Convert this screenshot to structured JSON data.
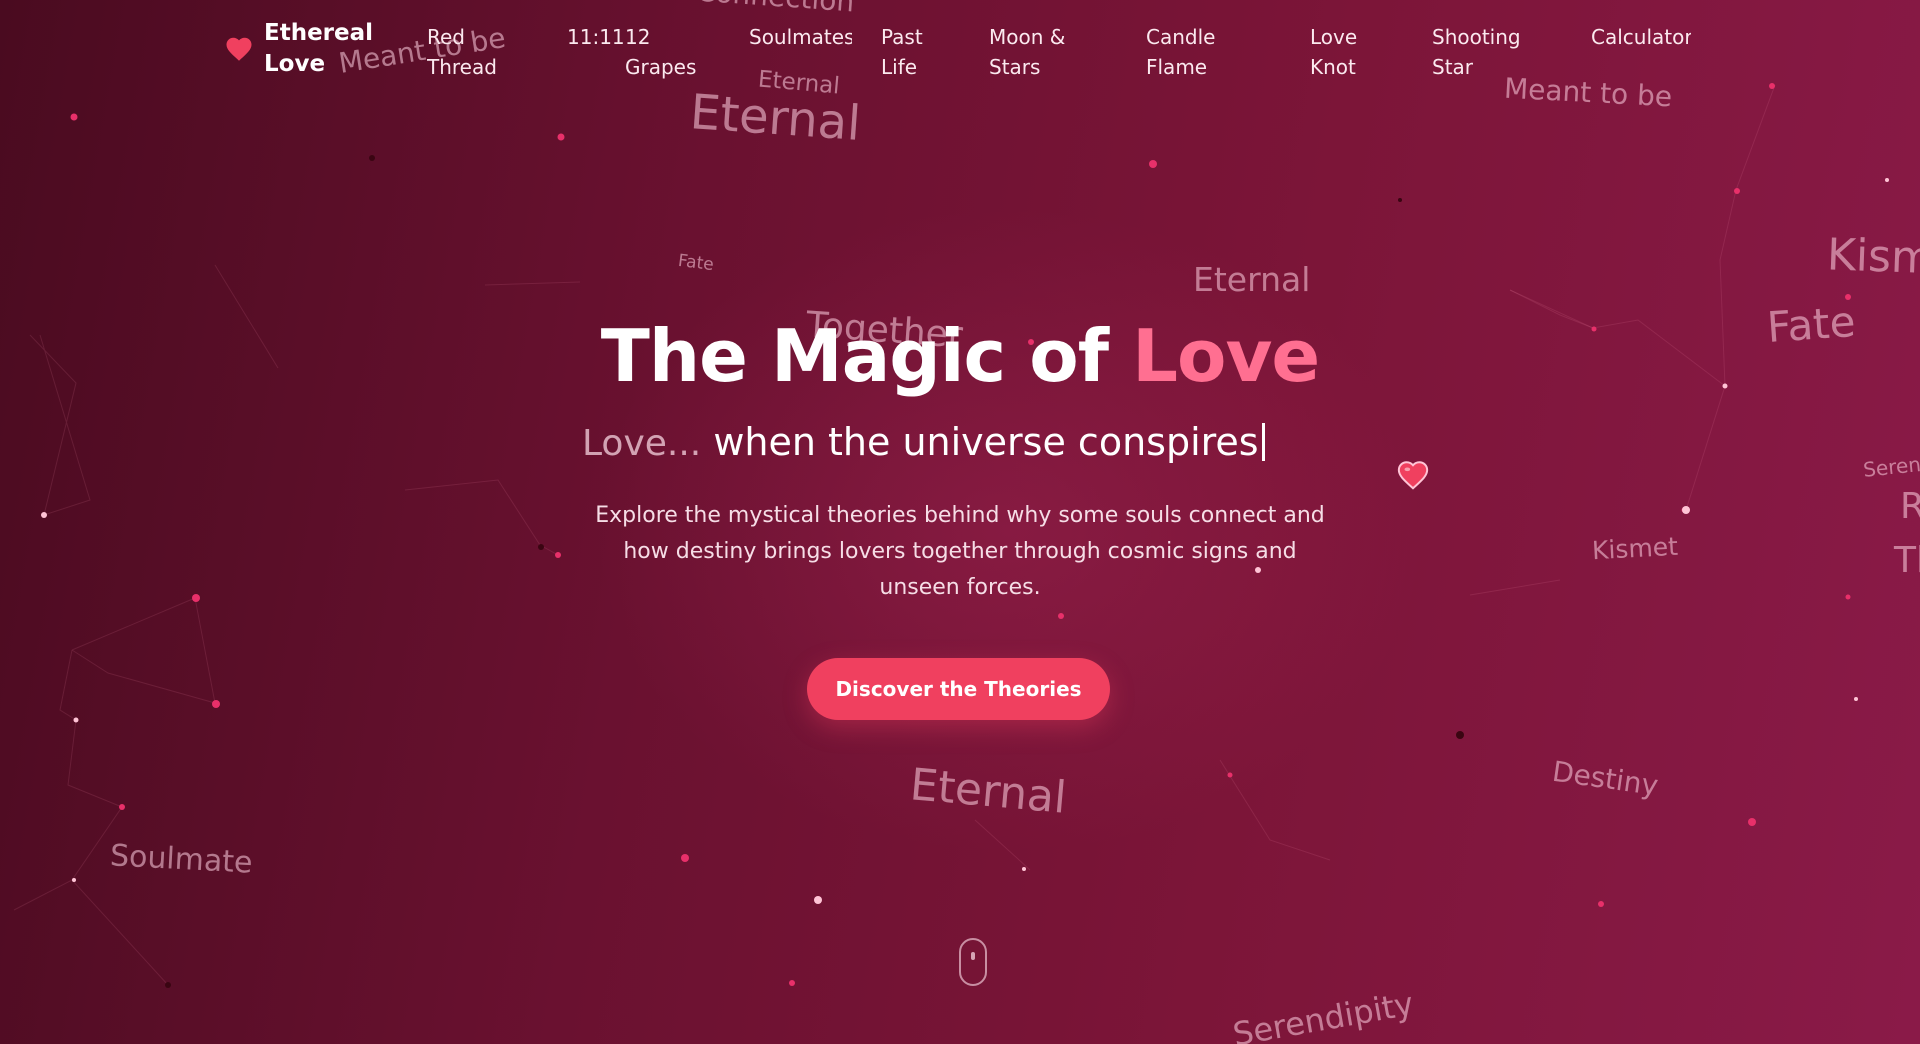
{
  "brand": {
    "name": "Ethereal Love",
    "icon": "heart-icon",
    "color": "#f0405f"
  },
  "nav": {
    "items": [
      {
        "label": "Red Thread"
      },
      {
        "label": "11:11"
      },
      {
        "label": "12 Grapes"
      },
      {
        "label": "Soulmates"
      },
      {
        "label": "Past Life"
      },
      {
        "label": "Moon & Stars"
      },
      {
        "label": "Candle Flame"
      },
      {
        "label": "Love Knot"
      },
      {
        "label": "Shooting Star"
      },
      {
        "label": "Calculator"
      }
    ]
  },
  "hero": {
    "title_main": "The Magic of ",
    "title_accent": "Love",
    "tagline_prefix": "Love...",
    "tagline_rest": " when the universe conspires",
    "description": "Explore the mystical theories behind why some souls connect and how destiny brings lovers together through cosmic signs and unseen forces.",
    "cta_label": "Discover the Theories"
  },
  "floating_words": [
    "Meant to be",
    "Connection",
    "Eternal",
    "Eternal",
    "Meant to be",
    "Fate",
    "Eternal",
    "Together",
    "Kismet",
    "Fate",
    "Serendipity",
    "R",
    "Tl",
    "Kismet",
    "Eternal",
    "Destiny",
    "Soulmate",
    "Serendipity"
  ],
  "colors": {
    "accent": "#ff6f91",
    "button": "#f0405f",
    "background_start": "#4a0b20",
    "background_end": "#8a1a48"
  }
}
